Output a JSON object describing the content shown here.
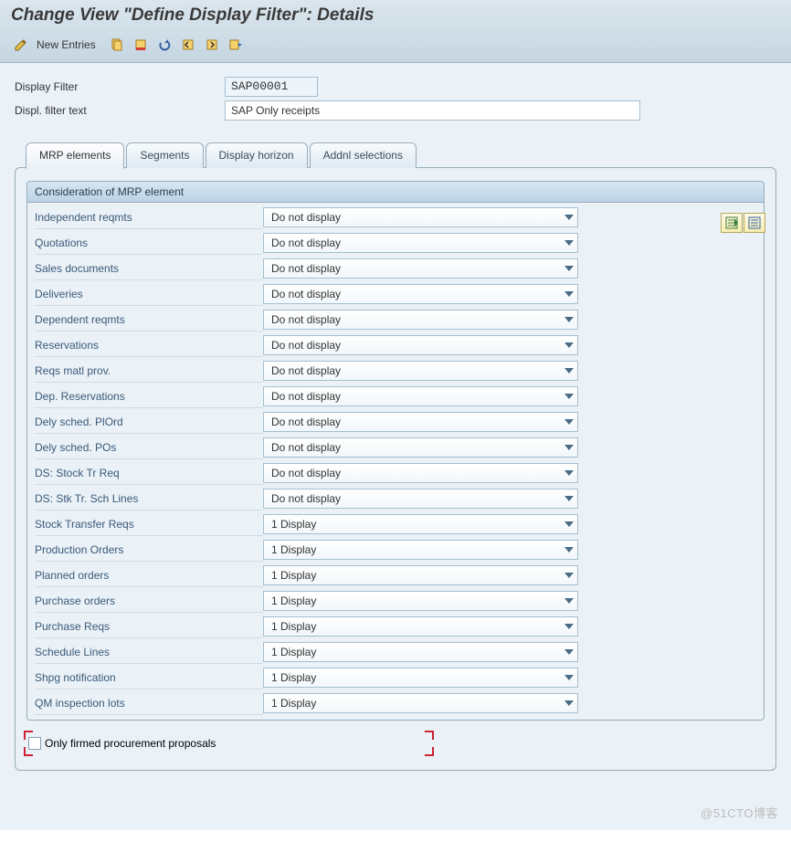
{
  "title": "Change View \"Define Display Filter\": Details",
  "toolbar": {
    "new_entries": "New Entries"
  },
  "header": {
    "display_filter_label": "Display Filter",
    "display_filter_value": "SAP00001",
    "display_filter_text_label": "Displ. filter text",
    "display_filter_text_value": "SAP Only receipts"
  },
  "tabs": [
    {
      "id": "mrp",
      "label": "MRP elements",
      "active": true
    },
    {
      "id": "seg",
      "label": "Segments",
      "active": false
    },
    {
      "id": "dh",
      "label": "Display horizon",
      "active": false
    },
    {
      "id": "add",
      "label": "Addnl selections",
      "active": false
    }
  ],
  "group_title": "Consideration of MRP element",
  "rows": [
    {
      "label": "Independent reqmts",
      "value": "Do not display"
    },
    {
      "label": "Quotations",
      "value": "Do not display"
    },
    {
      "label": "Sales documents",
      "value": "Do not display"
    },
    {
      "label": "Deliveries",
      "value": "Do not display"
    },
    {
      "label": "Dependent reqmts",
      "value": "Do not display"
    },
    {
      "label": "Reservations",
      "value": "Do not display"
    },
    {
      "label": "Reqs matl prov.",
      "value": "Do not display"
    },
    {
      "label": "Dep. Reservations",
      "value": "Do not display"
    },
    {
      "label": "Dely sched. PlOrd",
      "value": "Do not display"
    },
    {
      "label": "Dely sched. POs",
      "value": "Do not display"
    },
    {
      "label": "DS: Stock Tr Req",
      "value": "Do not display"
    },
    {
      "label": "DS: Stk Tr. Sch Lines",
      "value": "Do not display"
    },
    {
      "label": "Stock Transfer Reqs",
      "value": "1 Display"
    },
    {
      "label": "Production Orders",
      "value": "1 Display"
    },
    {
      "label": "Planned orders",
      "value": "1 Display"
    },
    {
      "label": "Purchase orders",
      "value": "1 Display"
    },
    {
      "label": "Purchase Reqs",
      "value": "1 Display"
    },
    {
      "label": "Schedule Lines",
      "value": "1 Display"
    },
    {
      "label": "Shpg notification",
      "value": "1 Display"
    },
    {
      "label": "QM inspection lots",
      "value": "1 Display"
    }
  ],
  "checkbox_label": "Only firmed procurement proposals",
  "watermark": "@51CTO博客"
}
